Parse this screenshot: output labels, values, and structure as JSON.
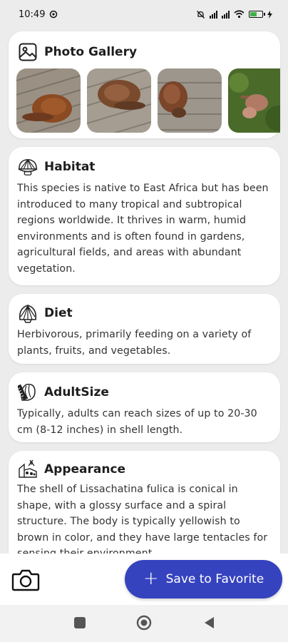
{
  "status": {
    "time": "10:49",
    "battery_color": "#3db34a"
  },
  "gallery": {
    "title": "Photo Gallery",
    "icon": "image-icon",
    "thumbnails": 4
  },
  "habitat": {
    "title": "Habitat",
    "icon": "shell-icon",
    "text": "This species is native to East Africa but has been introduced to many tropical and subtropical regions worldwide. It thrives in warm, humid environments and is often found in gardens, agricultural fields, and areas with abundant vegetation."
  },
  "diet": {
    "title": "Diet",
    "icon": "shell-icon",
    "text": "Herbivorous, primarily feeding on a variety of plants, fruits, and vegetables."
  },
  "adult_size": {
    "title": "AdultSize",
    "icon": "ruler-shell-icon",
    "text": "Typically, adults can reach sizes of up to 20-30 cm (8-12 inches) in shell length."
  },
  "appearance": {
    "title": "Appearance",
    "icon": "palette-icon",
    "text": "The shell of Lissachatina fulica is conical in shape, with a glossy surface and a spiral structure. The body is typically yellowish to brown in color, and they have large tentacles for sensing their environment."
  },
  "actions": {
    "save_label": "Save to Favorite",
    "accent": "#3643bf"
  }
}
